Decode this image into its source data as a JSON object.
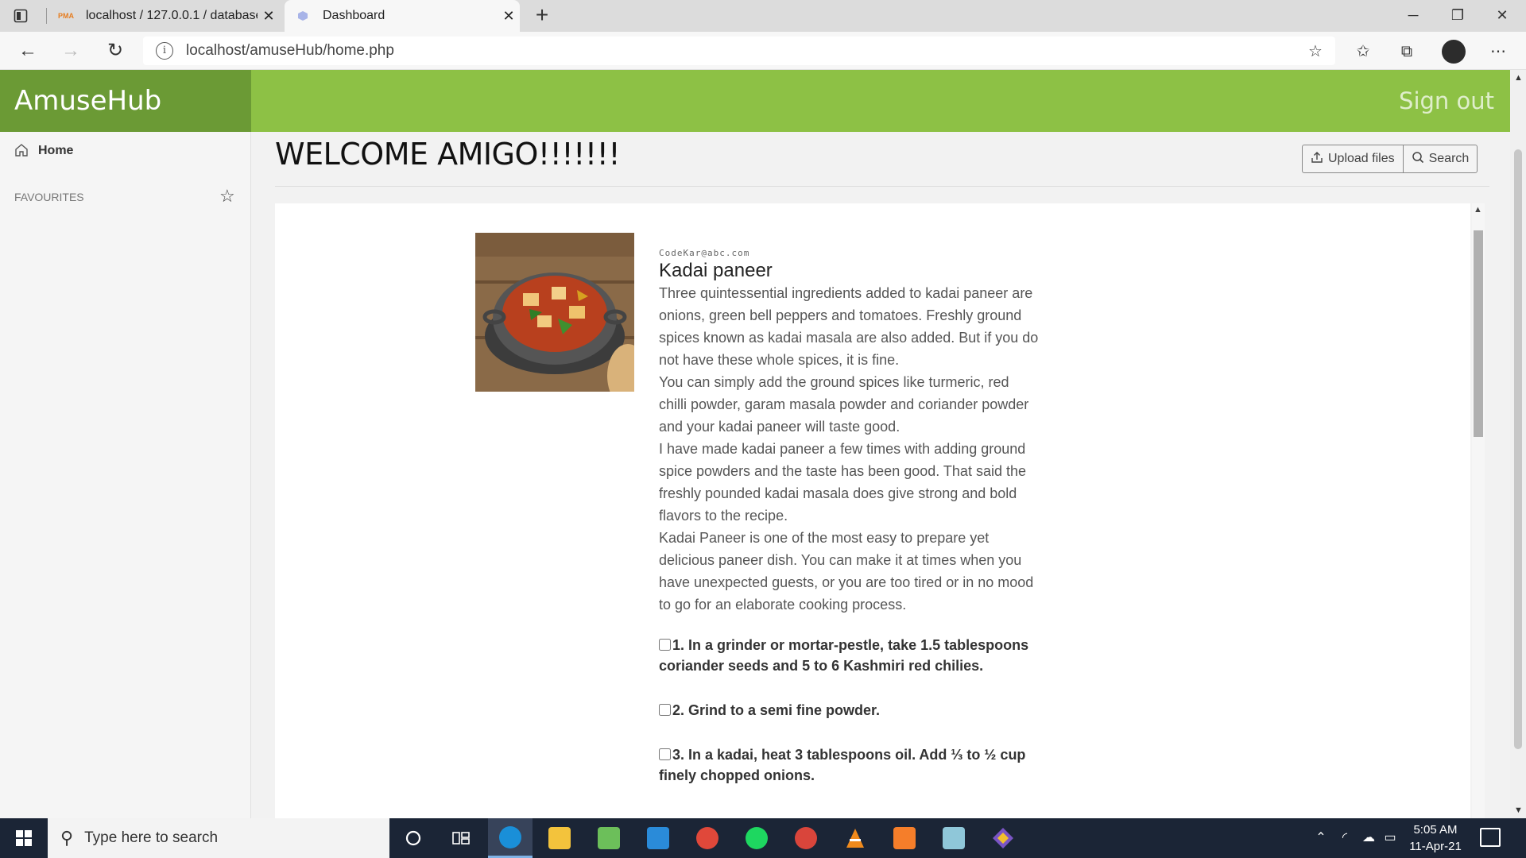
{
  "browser": {
    "tabs": [
      {
        "title": "localhost / 127.0.0.1 / database /",
        "favicon": "pma",
        "active": false
      },
      {
        "title": "Dashboard",
        "favicon": "dashboard-icon",
        "active": true
      }
    ],
    "url": "localhost/amuseHub/home.php"
  },
  "app": {
    "brand": "AmuseHub",
    "signout": "Sign out",
    "header_color": "#8dc145",
    "brand_color": "#6b9a35"
  },
  "sidebar": {
    "home_label": "Home",
    "favourites_label": "FAVOURITES"
  },
  "main": {
    "welcome": "WELCOME AMIGO!!!!!!!",
    "upload_label": "Upload files",
    "search_label": "Search"
  },
  "post": {
    "author": "CodeKar@abc.com",
    "title": "Kadai paneer",
    "paragraphs": [
      "Three quintessential ingredients added to kadai paneer are onions, green bell peppers and tomatoes. Freshly ground spices known as kadai masala are also added. But if you do not have these whole spices, it is fine.",
      "You can simply add the ground spices like turmeric, red chilli powder, garam masala powder and coriander powder and your kadai paneer will taste good.",
      "I have made kadai paneer a few times with adding ground spice powders and the taste has been good. That said the freshly pounded kadai masala does give strong and bold flavors to the recipe.",
      "Kadai Paneer is one of the most easy to prepare yet delicious paneer dish. You can make it at times when you have unexpected guests, or you are too tired or in no mood to go for an elaborate cooking process."
    ],
    "steps": [
      "1. In a grinder or mortar-pestle, take 1.5 tablespoons coriander seeds and 5 to 6 Kashmiri red chilies.",
      "2. Grind to a semi fine powder.",
      "3. In a kadai, heat 3 tablespoons oil. Add ⅓ to ½ cup finely chopped onions."
    ]
  },
  "taskbar": {
    "search_placeholder": "Type here to search",
    "time": "5:05 AM",
    "date": "11-Apr-21"
  }
}
